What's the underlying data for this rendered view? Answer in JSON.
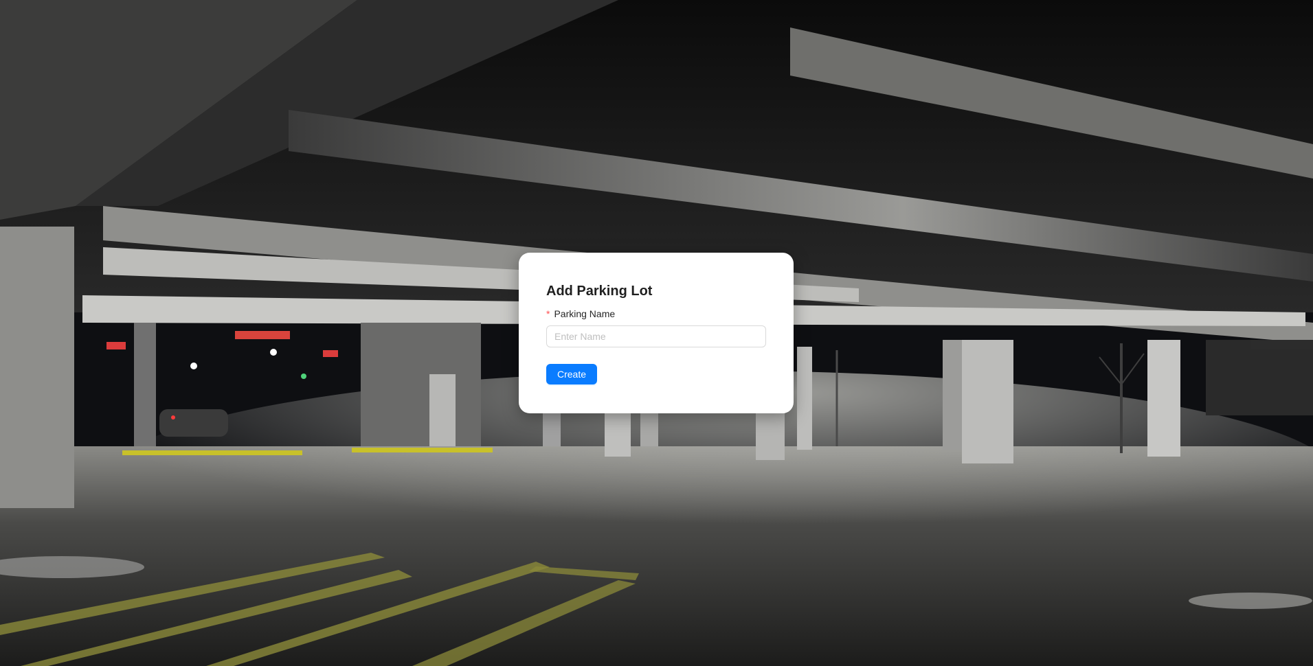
{
  "background": {
    "scene": "dark parking garage photo"
  },
  "modal": {
    "title": "Add Parking Lot",
    "required_mark": "*",
    "field_label": "Parking Name",
    "input_value": "",
    "input_placeholder": "Enter Name",
    "create_label": "Create"
  },
  "colors": {
    "primary_button": "#0a7cff",
    "required_mark": "#ff4d4f",
    "modal_background": "#ffffff"
  }
}
